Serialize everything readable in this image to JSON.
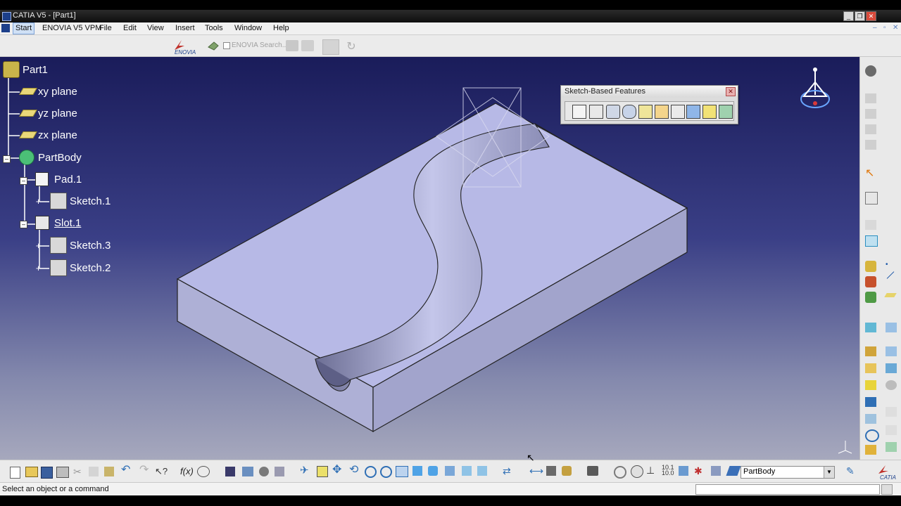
{
  "window": {
    "title": "CATIA V5 - [Part1]"
  },
  "menu": [
    "Start",
    "ENOVIA V5 VPM",
    "File",
    "Edit",
    "View",
    "Insert",
    "Tools",
    "Window",
    "Help"
  ],
  "top_toolbar": {
    "search_label": "ENOVIA Search..."
  },
  "tree": {
    "root": "Part1",
    "items": [
      "xy plane",
      "yz plane",
      "zx plane",
      "PartBody",
      "Pad.1",
      "Sketch.1",
      "Slot.1",
      "Sketch.3",
      "Sketch.2"
    ]
  },
  "palette": {
    "title": "Sketch-Based Features"
  },
  "bottom_toolbar": {
    "body_select": "PartBody"
  },
  "status": {
    "message": "Select an object or a command"
  },
  "colors": {
    "accent": "#1c3f8a",
    "viewport_top": "#1a1c5a",
    "viewport_bottom": "#a6a8bd",
    "part_face": "#b7b9e6"
  }
}
